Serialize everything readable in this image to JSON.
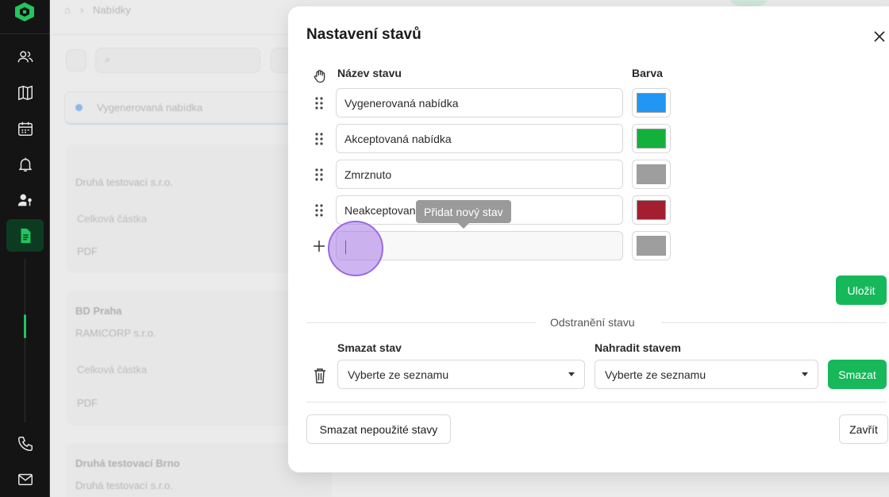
{
  "background": {
    "breadcrumb": "Nabídky",
    "filter_status": "Vygenerovaná nabídka",
    "cards": [
      {
        "title": "",
        "company": "Druhá testovací s.r.o.",
        "amount_label": "Celková částka",
        "format": "PDF"
      },
      {
        "title": "BD Praha",
        "company": "RAMICORP s.r.o.",
        "amount_label": "Celková částka",
        "format": "PDF"
      },
      {
        "title": "Druhá testovací Brno",
        "company": "Druhá testovací s.r.o.",
        "amount_label": "",
        "format": ""
      }
    ]
  },
  "sidebar": {
    "items": [
      {
        "icon": "users-icon"
      },
      {
        "icon": "map-icon"
      },
      {
        "icon": "calendar-icon"
      },
      {
        "icon": "bell-icon"
      },
      {
        "icon": "user-key-icon"
      },
      {
        "icon": "document-icon",
        "active": true
      },
      {
        "icon": "phone-icon"
      },
      {
        "icon": "mail-icon"
      }
    ]
  },
  "modal": {
    "title": "Nastavení stavů",
    "name_column": "Název stavu",
    "color_column": "Barva",
    "states": [
      {
        "name": "Vygenerovaná nabídka",
        "color": "#2196f3"
      },
      {
        "name": "Akceptovaná nabídka",
        "color": "#14b03c"
      },
      {
        "name": "Zmrznuto",
        "color": "#9e9e9e"
      },
      {
        "name": "Neakceptovaná nabídka",
        "color": "#a31f30"
      }
    ],
    "new_state": {
      "value": "",
      "color": "#9e9e9e"
    },
    "tooltip": "Přidat nový stav",
    "save_label": "Uložit",
    "removal": {
      "section_label": "Odstranění stavu",
      "delete_label": "Smazat stav",
      "replace_label": "Nahradit stavem",
      "delete_select": "Vyberte ze seznamu",
      "replace_select": "Vyberte ze seznamu",
      "delete_button": "Smazat"
    },
    "delete_unused_label": "Smazat nepoužité stavy",
    "close_label": "Zavřít"
  }
}
